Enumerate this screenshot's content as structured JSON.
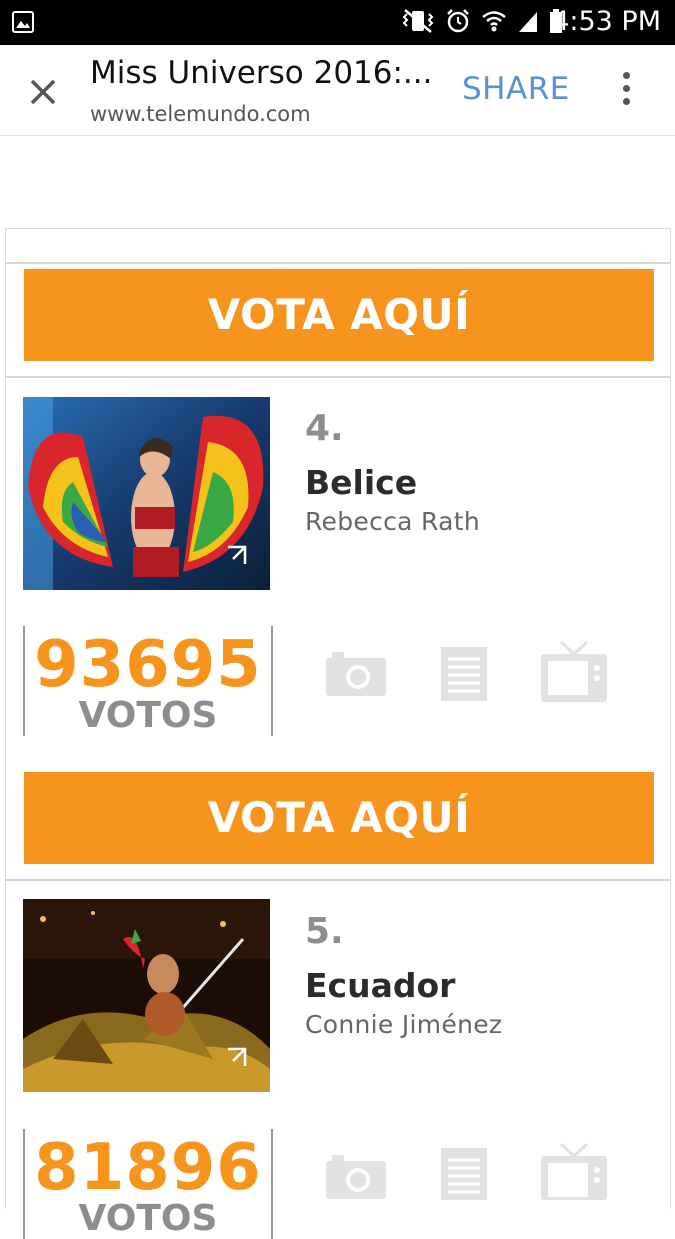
{
  "status_bar": {
    "time": "4:53 PM",
    "icons": [
      "gallery-icon",
      "mute-vibrate-icon",
      "alarm-icon",
      "wifi-icon",
      "signal-icon",
      "battery-icon"
    ]
  },
  "toolbar": {
    "title": "Miss Universo 2016:...",
    "url": "www.telemundo.com",
    "share_label": "SHARE",
    "icons": [
      "close-icon",
      "more-vert-icon"
    ]
  },
  "vote_button_label": "VOTA AQUÍ",
  "votes_unit": "VOTOS",
  "entries": [
    {
      "rank": "4.",
      "country": "Belice",
      "name": "Rebecca Rath",
      "votes": "93695"
    },
    {
      "rank": "5.",
      "country": "Ecuador",
      "name": "Connie Jiménez",
      "votes": "81896"
    }
  ],
  "media_icons": [
    "camera-icon",
    "article-icon",
    "tv-icon"
  ],
  "colors": {
    "accent": "#f7941e",
    "share": "#5b8fdd",
    "status_bar": "#000000"
  }
}
